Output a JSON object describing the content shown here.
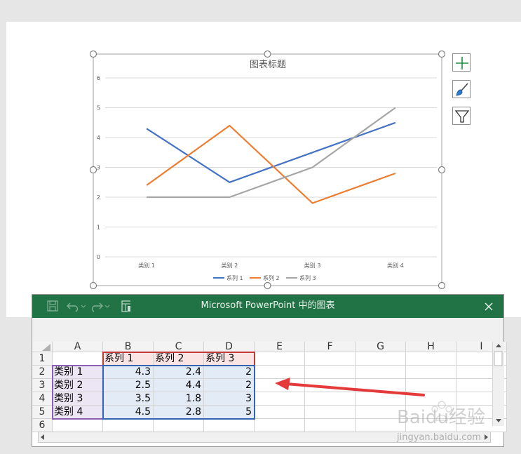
{
  "chart_data": {
    "type": "line",
    "title": "图表标题",
    "categories": [
      "类别 1",
      "类别 2",
      "类别 3",
      "类别 4"
    ],
    "series": [
      {
        "name": "系列 1",
        "values": [
          4.3,
          2.5,
          3.5,
          4.5
        ],
        "color": "#4472c4"
      },
      {
        "name": "系列 2",
        "values": [
          2.4,
          4.4,
          1.8,
          2.8
        ],
        "color": "#ed7d31"
      },
      {
        "name": "系列 3",
        "values": [
          2,
          2,
          3,
          5
        ],
        "color": "#a5a5a5"
      }
    ],
    "ylim": [
      0,
      6
    ],
    "yticks": [
      "0",
      "1",
      "2",
      "3",
      "4",
      "5",
      "6"
    ],
    "grid": true,
    "legend_position": "bottom"
  },
  "chart_side_buttons": [
    {
      "icon": "plus-icon",
      "color": "#1e8f3e"
    },
    {
      "icon": "brush-icon",
      "color": "#2e7bd1"
    },
    {
      "icon": "filter-icon",
      "color": "#333333"
    }
  ],
  "excel_window": {
    "title": "Microsoft PowerPoint 中的图表",
    "close_icon": "close-icon",
    "toolbar_icons": [
      "save-icon",
      "undo-icon",
      "redo-icon",
      "edit-data-in-excel-icon"
    ],
    "theme_color": "#217346",
    "columns": [
      "A",
      "B",
      "C",
      "D",
      "E",
      "F",
      "G",
      "H",
      "I"
    ],
    "rows": [
      "1",
      "2",
      "3",
      "4",
      "5",
      "6"
    ],
    "header_row": [
      "",
      "系列 1",
      "系列 2",
      "系列 3"
    ],
    "data_rows": [
      {
        "label": "类别 1",
        "values": [
          "4.3",
          "2.4",
          "2"
        ]
      },
      {
        "label": "类别 2",
        "values": [
          "2.5",
          "4.4",
          "2"
        ]
      },
      {
        "label": "类别 3",
        "values": [
          "3.5",
          "1.8",
          "3"
        ]
      },
      {
        "label": "类别 4",
        "values": [
          "4.5",
          "2.8",
          "5"
        ]
      }
    ]
  },
  "annotation_arrow_color": "#e53a3a",
  "watermark": {
    "logo_text": "Baidu经验",
    "url_text": "jingyan.baidu.com"
  }
}
